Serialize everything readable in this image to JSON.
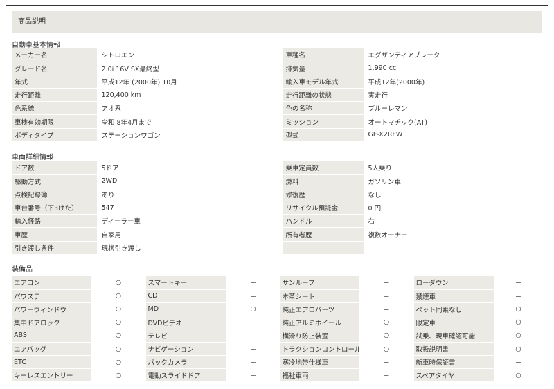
{
  "header": {
    "title": "商品説明"
  },
  "basic": {
    "title": "自動車基本情報",
    "rows": [
      [
        "メーカー名",
        "シトロエン",
        "車種名",
        "エグザンティアブレーク"
      ],
      [
        "グレード名",
        "2.0i 16V SX最終型",
        "排気量",
        "1,990 cc"
      ],
      [
        "年式",
        "平成12年 (2000年) 10月",
        "輸入車モデル年式",
        "平成12年(2000年)"
      ],
      [
        "走行距離",
        "120,400 km",
        "走行距離の状態",
        "実走行"
      ],
      [
        "色系統",
        "アオ系",
        "色の名称",
        "ブルーレマン"
      ],
      [
        "車検有効期限",
        "令和 8年4月まで",
        "ミッション",
        "オートマチック(AT)"
      ],
      [
        "ボディタイプ",
        "ステーションワゴン",
        "型式",
        "GF-X2RFW"
      ]
    ]
  },
  "detail": {
    "title": "車両詳細情報",
    "rows": [
      [
        "ドア数",
        "5ドア",
        "乗車定員数",
        "5人乗り"
      ],
      [
        "駆動方式",
        "2WD",
        "燃料",
        "ガソリン車"
      ],
      [
        "点検記録簿",
        "あり",
        "修復歴",
        "なし"
      ],
      [
        "車台番号（下3けた）",
        "547",
        "リサイクル預託金",
        "0 円"
      ],
      [
        "輸入経路",
        "ディーラー車",
        "ハンドル",
        "右"
      ],
      [
        "車歴",
        "自家用",
        "所有者歴",
        "複数オーナー"
      ],
      [
        "引き渡し条件",
        "現状引き渡し",
        "",
        ""
      ]
    ]
  },
  "equipment": {
    "title": "装備品",
    "rows": [
      [
        "エアコン",
        "○",
        "スマートキー",
        "－",
        "サンルーフ",
        "－",
        "ローダウン",
        "－"
      ],
      [
        "パワステ",
        "○",
        "CD",
        "－",
        "本革シート",
        "－",
        "禁煙車",
        "－"
      ],
      [
        "パワーウィンドウ",
        "○",
        "MD",
        "○",
        "純正エアロパーツ",
        "－",
        "ペット同乗なし",
        "○"
      ],
      [
        "集中ドアロック",
        "○",
        "DVDビデオ",
        "－",
        "純正アルミホイール",
        "○",
        "限定車",
        "○"
      ],
      [
        "ABS",
        "○",
        "テレビ",
        "－",
        "横滑り防止装置",
        "○",
        "試乗、現車確認可能",
        "○"
      ],
      [
        "エアバッグ",
        "○",
        "ナビゲーション",
        "－",
        "トラクションコントロール",
        "○",
        "取扱説明書",
        "○"
      ],
      [
        "ETC",
        "○",
        "バックカメラ",
        "－",
        "寒冷地帯仕様車",
        "－",
        "新車時保証書",
        "－"
      ],
      [
        "キーレスエントリー",
        "○",
        "電動スライドドア",
        "－",
        "福祉車両",
        "－",
        "スペアタイヤ",
        "○"
      ]
    ]
  }
}
